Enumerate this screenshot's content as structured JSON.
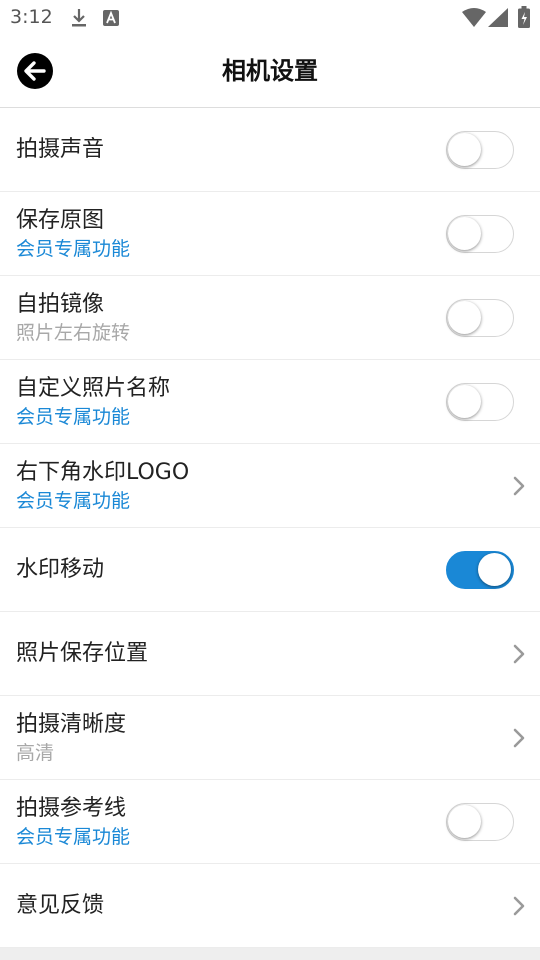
{
  "status_bar": {
    "time": "3:12",
    "icons": [
      "download-icon",
      "a-box-icon",
      "wifi-icon",
      "signal-icon",
      "battery-icon"
    ]
  },
  "header": {
    "title": "相机设置",
    "back_icon": "back-arrow-icon"
  },
  "colors": {
    "accent": "#1a88d6",
    "subtitle_grey": "#a8a8a8",
    "title_text": "#222222"
  },
  "settings": [
    {
      "id": "shutter-sound",
      "title": "拍摄声音",
      "subtitle": "",
      "control": "toggle",
      "on": false
    },
    {
      "id": "save-original",
      "title": "保存原图",
      "subtitle": "会员专属功能",
      "subtitle_style": "member",
      "control": "toggle",
      "on": false
    },
    {
      "id": "selfie-mirror",
      "title": "自拍镜像",
      "subtitle": "照片左右旋转",
      "subtitle_style": "grey",
      "control": "toggle",
      "on": false
    },
    {
      "id": "custom-photo-name",
      "title": "自定义照片名称",
      "subtitle": "会员专属功能",
      "subtitle_style": "member",
      "control": "toggle",
      "on": false
    },
    {
      "id": "watermark-logo",
      "title": "右下角水印LOGO",
      "subtitle": "会员专属功能",
      "subtitle_style": "member",
      "control": "chevron"
    },
    {
      "id": "watermark-move",
      "title": "水印移动",
      "subtitle": "",
      "control": "toggle",
      "on": true
    },
    {
      "id": "photo-save-location",
      "title": "照片保存位置",
      "subtitle": "",
      "control": "chevron"
    },
    {
      "id": "capture-quality",
      "title": "拍摄清晰度",
      "subtitle": "高清",
      "subtitle_style": "grey",
      "control": "chevron"
    },
    {
      "id": "grid-lines",
      "title": "拍摄参考线",
      "subtitle": "会员专属功能",
      "subtitle_style": "member",
      "control": "toggle",
      "on": false
    },
    {
      "id": "feedback",
      "title": "意见反馈",
      "subtitle": "",
      "control": "chevron"
    }
  ]
}
